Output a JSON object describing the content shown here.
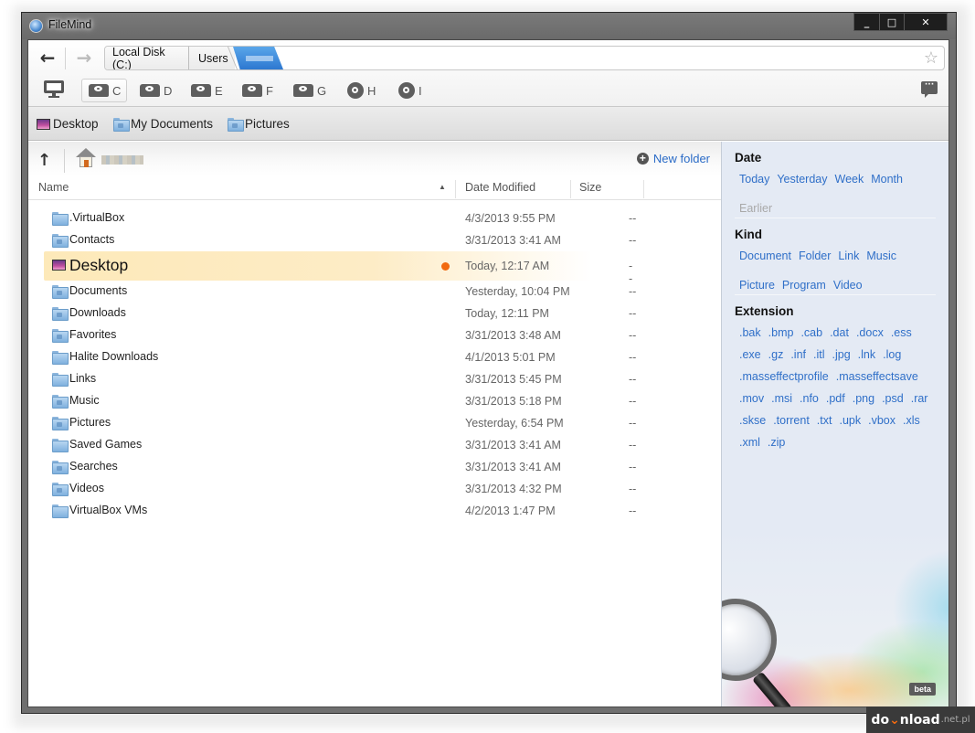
{
  "window": {
    "title": "FileMind",
    "controls": {
      "minimize": "_",
      "maximize": "□",
      "close": "✕"
    }
  },
  "toolbar": {
    "back_icon": "←",
    "forward_icon": "→",
    "breadcrumb": [
      "Local Disk (C:)",
      "Users",
      ""
    ],
    "star_icon": "☆",
    "chat_icon": "···",
    "drives": [
      {
        "letter": "C",
        "type": "hdd",
        "active": true
      },
      {
        "letter": "D",
        "type": "hdd"
      },
      {
        "letter": "E",
        "type": "hdd"
      },
      {
        "letter": "F",
        "type": "hdd"
      },
      {
        "letter": "G",
        "type": "hdd"
      },
      {
        "letter": "H",
        "type": "cd"
      },
      {
        "letter": "I",
        "type": "cd"
      }
    ]
  },
  "favorites": [
    {
      "label": "Desktop",
      "icon": "desktop-icon"
    },
    {
      "label": "My Documents",
      "icon": "documents-folder-icon"
    },
    {
      "label": "Pictures",
      "icon": "pictures-folder-icon"
    }
  ],
  "pathbar": {
    "up_icon": "↑",
    "new_folder": "New folder",
    "plus_icon": "+"
  },
  "columns": {
    "name": "Name",
    "date": "Date Modified",
    "size": "Size",
    "sort_icon": "▲"
  },
  "files": [
    {
      "name": ".VirtualBox",
      "date": "4/3/2013 9:55 PM",
      "size": "--",
      "icon": "folder"
    },
    {
      "name": "Contacts",
      "date": "3/31/2013 3:41 AM",
      "size": "--",
      "icon": "contacts-folder"
    },
    {
      "name": "Desktop",
      "date": "Today, 12:17 AM",
      "size": "--",
      "icon": "desktop",
      "selected": true
    },
    {
      "name": "Documents",
      "date": "Yesterday, 10:04 PM",
      "size": "--",
      "icon": "documents-folder"
    },
    {
      "name": "Downloads",
      "date": "Today, 12:11 PM",
      "size": "--",
      "icon": "downloads-folder"
    },
    {
      "name": "Favorites",
      "date": "3/31/2013 3:48 AM",
      "size": "--",
      "icon": "favorites-folder"
    },
    {
      "name": "Halite Downloads",
      "date": "4/1/2013 5:01 PM",
      "size": "--",
      "icon": "folder"
    },
    {
      "name": "Links",
      "date": "3/31/2013 5:45 PM",
      "size": "--",
      "icon": "folder"
    },
    {
      "name": "Music",
      "date": "3/31/2013 5:18 PM",
      "size": "--",
      "icon": "music-folder"
    },
    {
      "name": "Pictures",
      "date": "Yesterday, 6:54 PM",
      "size": "--",
      "icon": "pictures-folder"
    },
    {
      "name": "Saved Games",
      "date": "3/31/2013 3:41 AM",
      "size": "--",
      "icon": "folder"
    },
    {
      "name": "Searches",
      "date": "3/31/2013 3:41 AM",
      "size": "--",
      "icon": "searches-folder"
    },
    {
      "name": "Videos",
      "date": "3/31/2013 4:32 PM",
      "size": "--",
      "icon": "videos-folder"
    },
    {
      "name": "VirtualBox VMs",
      "date": "4/2/2013 1:47 PM",
      "size": "--",
      "icon": "folder"
    }
  ],
  "sidebar": {
    "date": {
      "title": "Date",
      "items": [
        "Today",
        "Yesterday",
        "Week",
        "Month"
      ],
      "disabled": [
        "Earlier"
      ]
    },
    "kind": {
      "title": "Kind",
      "items": [
        "Document",
        "Folder",
        "Link",
        "Music",
        "Picture",
        "Program",
        "Video"
      ]
    },
    "extension": {
      "title": "Extension",
      "items": [
        ".bak",
        ".bmp",
        ".cab",
        ".dat",
        ".docx",
        ".ess",
        ".exe",
        ".gz",
        ".inf",
        ".itl",
        ".jpg",
        ".lnk",
        ".log",
        ".masseffectprofile",
        ".masseffectsave",
        ".mov",
        ".msi",
        ".nfo",
        ".pdf",
        ".png",
        ".psd",
        ".rar",
        ".skse",
        ".torrent",
        ".txt",
        ".upk",
        ".vbox",
        ".xls",
        ".xml",
        ".zip"
      ]
    },
    "badge": "beta"
  },
  "watermark": {
    "a": "do",
    "b": "⌄",
    "c": "nload",
    "d": ".net.pl"
  },
  "colors": {
    "accent": "#2f6fc8",
    "selection": "#fde9b9",
    "dot": "#f26a10",
    "sidebar_bg": "#e4eaf4"
  }
}
